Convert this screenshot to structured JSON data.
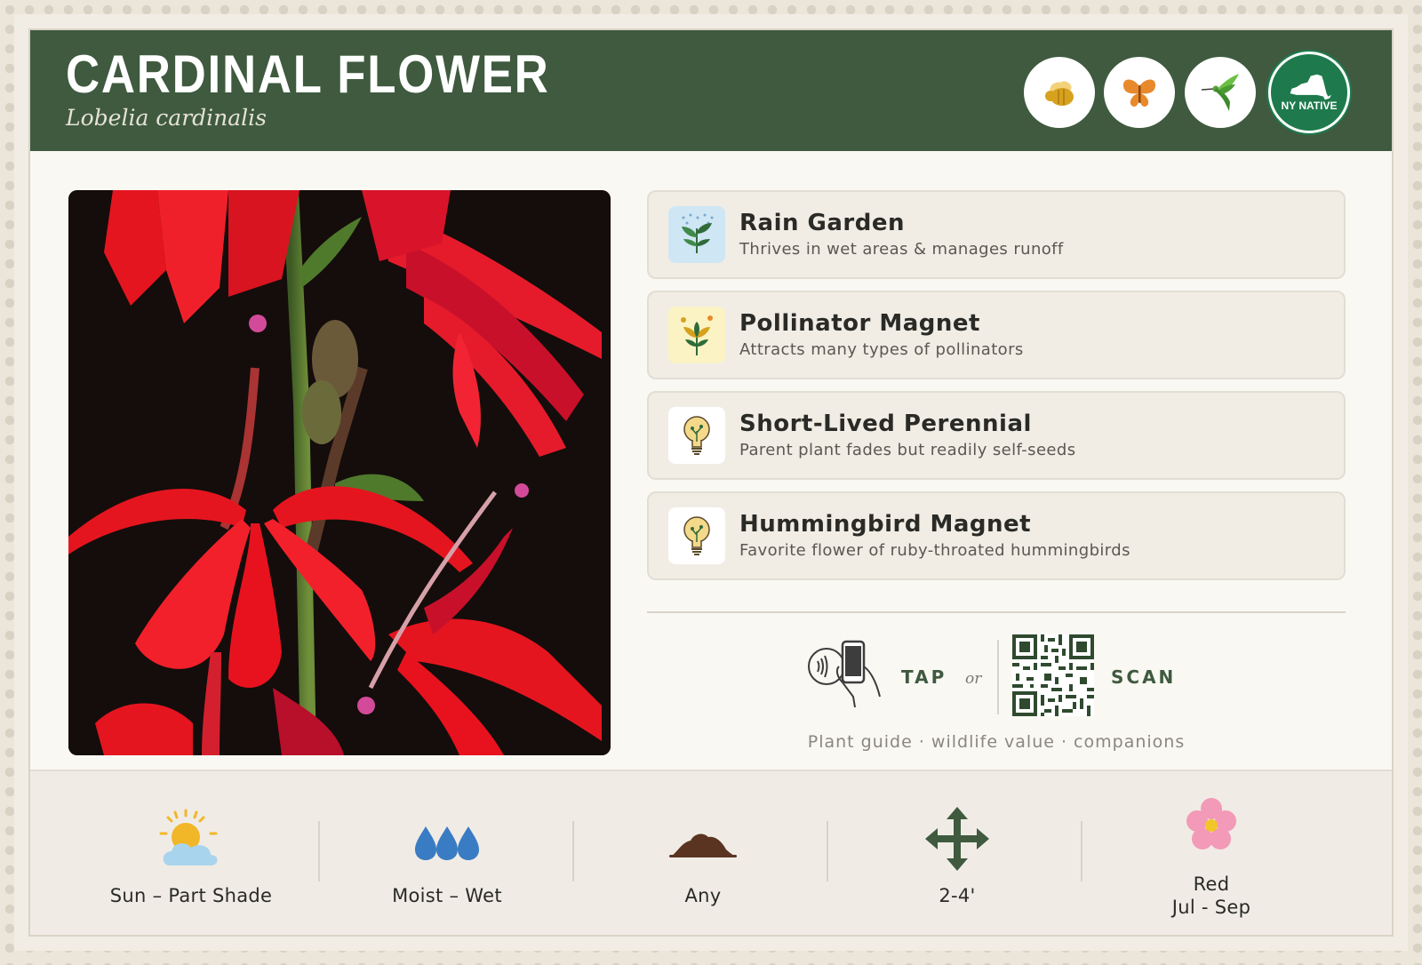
{
  "header": {
    "common_name": "CARDINAL FLOWER",
    "scientific_name": "Lobelia cardinalis",
    "badges": [
      {
        "icon": "bee-icon",
        "color": "#d6a21e"
      },
      {
        "icon": "butterfly-icon",
        "color": "#e8892b"
      },
      {
        "icon": "hummingbird-icon",
        "color": "#5aa33a"
      },
      {
        "icon": "ny-state-icon",
        "label": "NY NATIVE",
        "color": "#1e7a4c"
      }
    ]
  },
  "photo": {
    "subject": "red-flower-photo"
  },
  "features": [
    {
      "title": "Rain Garden",
      "description": "Thrives in wet areas & manages runoff",
      "icon": "rain-plant-icon",
      "icon_bg": "#cfe6f5"
    },
    {
      "title": "Pollinator Magnet",
      "description": "Attracts many types of pollinators",
      "icon": "pollinator-flower-icon",
      "icon_bg": "#fbf3c4"
    },
    {
      "title": "Short-Lived Perennial",
      "description": "Parent plant fades but readily self-seeds",
      "icon": "lightbulb-icon",
      "icon_bg": "#ffffff"
    },
    {
      "title": "Hummingbird Magnet",
      "description": "Favorite flower of ruby-throated hummingbirds",
      "icon": "lightbulb-icon",
      "icon_bg": "#ffffff"
    }
  ],
  "connect": {
    "tap_label": "TAP",
    "or_label": "or",
    "scan_label": "SCAN",
    "guide_text": "Plant guide · wildlife value · companions"
  },
  "stats": [
    {
      "icon": "sun-cloud-icon",
      "label": "Sun – Part Shade"
    },
    {
      "icon": "water-drops-icon",
      "label": "Moist – Wet"
    },
    {
      "icon": "soil-icon",
      "label": "Any"
    },
    {
      "icon": "spread-arrows-icon",
      "label": "2-4'"
    },
    {
      "icon": "flower-icon",
      "label_line1": "Red",
      "label_line2": "Jul - Sep"
    }
  ],
  "colors": {
    "header_green": "#3f5a3f",
    "accent_green": "#3f5a3f",
    "card_bg": "#faf8f3",
    "strip_bg": "#f0ece5"
  }
}
